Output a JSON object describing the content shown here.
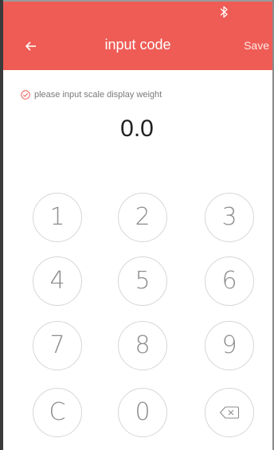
{
  "status_bar": {
    "bluetooth_icon": "bluetooth-icon"
  },
  "header": {
    "back_icon": "arrow-left-icon",
    "title": "input code",
    "save_label": "Save",
    "background_color": "#ee5c55"
  },
  "hint": {
    "icon": "check-circle-icon",
    "text": "please input scale display weight"
  },
  "display": {
    "value": "0.0"
  },
  "keypad": {
    "keys": [
      "1",
      "2",
      "3",
      "4",
      "5",
      "6",
      "7",
      "8",
      "9",
      "C",
      "0"
    ],
    "delete_icon": "backspace-icon"
  }
}
